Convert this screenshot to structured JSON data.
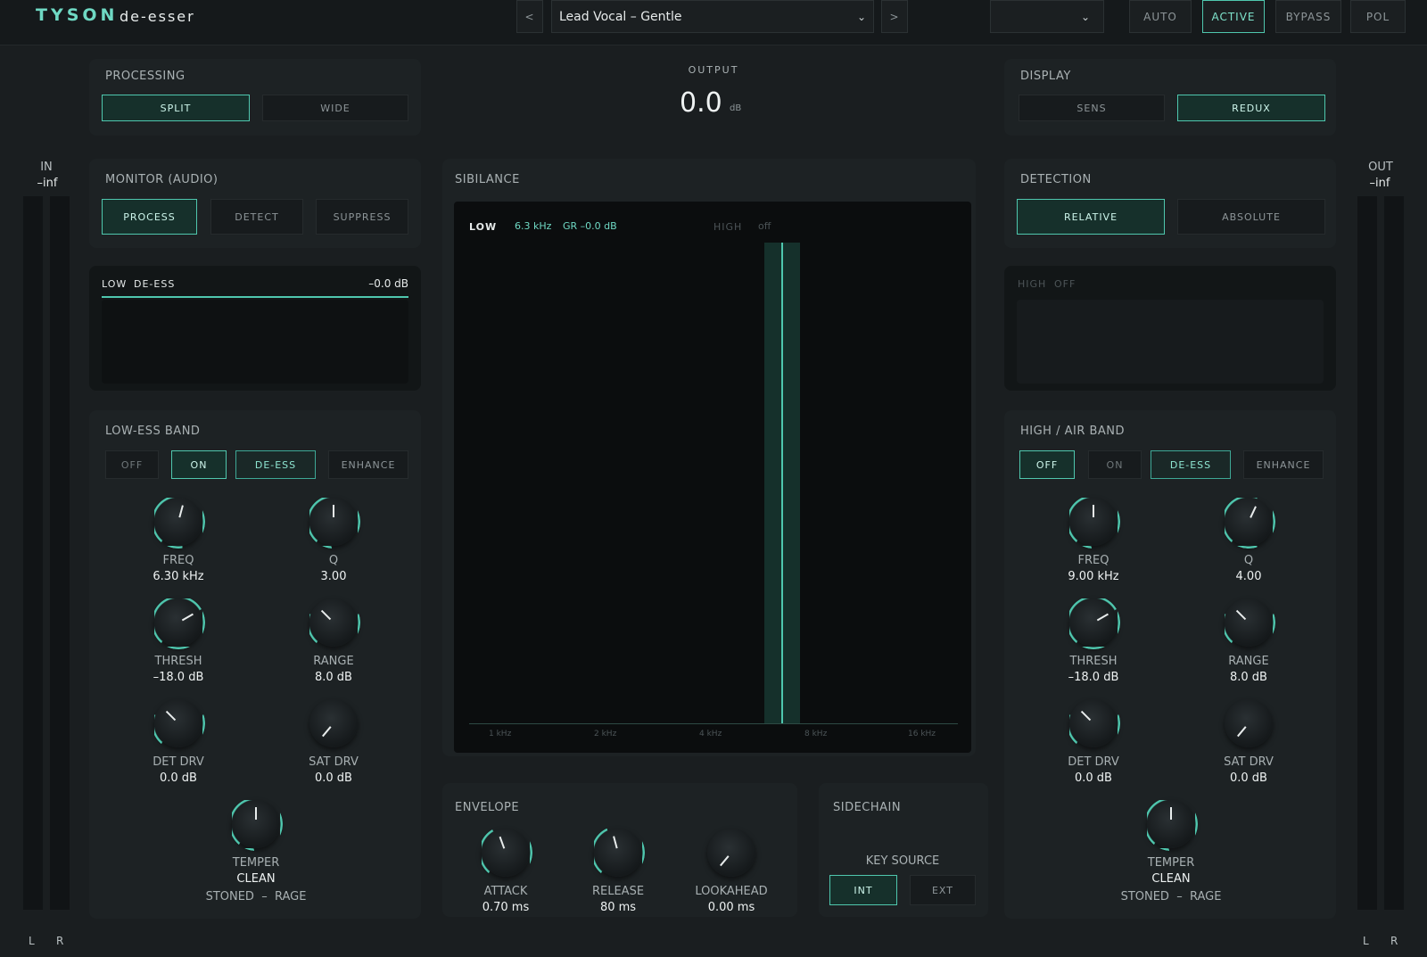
{
  "header": {
    "brand": "TYSON",
    "product": "de-esser",
    "prev": "<",
    "next": ">",
    "preset": "Lead Vocal – Gentle",
    "auto": "AUTO",
    "active": "ACTIVE",
    "bypass": "BYPASS",
    "pol": "POL"
  },
  "processing": {
    "title": "PROCESSING",
    "split": "SPLIT",
    "wide": "WIDE"
  },
  "output": {
    "title": "OUTPUT",
    "value": "0.0",
    "unit": "dB"
  },
  "display": {
    "title": "DISPLAY",
    "sens": "SENS",
    "redux": "REDUX"
  },
  "meters": {
    "in_label": "IN",
    "in_value": "–inf",
    "out_label": "OUT",
    "out_value": "–inf",
    "l": "L",
    "r": "R"
  },
  "monitor": {
    "title": "MONITOR (AUDIO)",
    "process": "PROCESS",
    "detect": "DETECT",
    "suppress": "SUPPRESS"
  },
  "low_screen": {
    "band": "LOW",
    "mode": "DE-ESS",
    "value": "–0.0 dB"
  },
  "sibilance": {
    "title": "SIBILANCE",
    "low": "LOW",
    "freq": "6.3 kHz",
    "gr": "GR –0.0 dB",
    "high": "HIGH",
    "high_state": "off",
    "ticks": [
      "1 kHz",
      "2 kHz",
      "4 kHz",
      "8 kHz",
      "16 kHz"
    ]
  },
  "detection": {
    "title": "DETECTION",
    "relative": "RELATIVE",
    "absolute": "ABSOLUTE"
  },
  "high_screen": {
    "band": "HIGH",
    "mode": "OFF"
  },
  "low_band": {
    "title": "LOW-ESS BAND",
    "off": "OFF",
    "on": "ON",
    "deess": "DE-ESS",
    "enhance": "ENHANCE",
    "freq_l": "FREQ",
    "freq_v": "6.30 kHz",
    "q_l": "Q",
    "q_v": "3.00",
    "thresh_l": "THRESH",
    "thresh_v": "–18.0 dB",
    "range_l": "RANGE",
    "range_v": "8.0 dB",
    "detdrv_l": "DET DRV",
    "detdrv_v": "0.0 dB",
    "satdrv_l": "SAT DRV",
    "satdrv_v": "0.0 dB",
    "temper_l": "TEMPER",
    "temper_v": "CLEAN",
    "temper_range": "STONED  –  RAGE"
  },
  "high_band": {
    "title": "HIGH / AIR BAND",
    "off": "OFF",
    "on": "ON",
    "deess": "DE-ESS",
    "enhance": "ENHANCE",
    "freq_l": "FREQ",
    "freq_v": "9.00 kHz",
    "q_l": "Q",
    "q_v": "4.00",
    "thresh_l": "THRESH",
    "thresh_v": "–18.0 dB",
    "range_l": "RANGE",
    "range_v": "8.0 dB",
    "detdrv_l": "DET DRV",
    "detdrv_v": "0.0 dB",
    "satdrv_l": "SAT DRV",
    "satdrv_v": "0.0 dB",
    "temper_l": "TEMPER",
    "temper_v": "CLEAN",
    "temper_range": "STONED  –  RAGE"
  },
  "envelope": {
    "title": "ENVELOPE",
    "attack_l": "ATTACK",
    "attack_v": "0.70 ms",
    "release_l": "RELEASE",
    "release_v": "80 ms",
    "look_l": "LOOKAHEAD",
    "look_v": "0.00 ms"
  },
  "sidechain": {
    "title": "SIDECHAIN",
    "key": "KEY SOURCE",
    "int": "INT",
    "ext": "EXT"
  },
  "colors": {
    "accent": "#4fc7ae",
    "bg": "#1a1e20"
  }
}
